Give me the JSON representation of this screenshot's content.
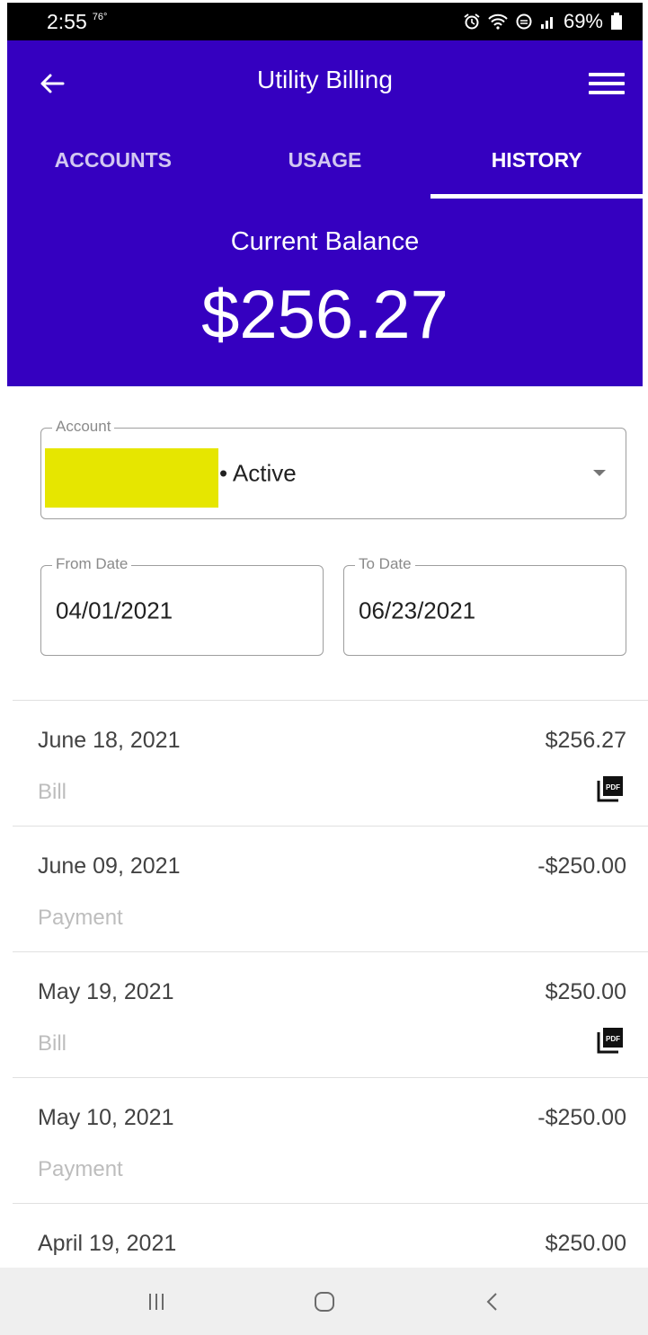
{
  "status_bar": {
    "time": "2:55",
    "temperature": "76°",
    "battery": "69%"
  },
  "header": {
    "title": "Utility Billing",
    "back_icon": "arrow-left-icon",
    "menu_icon": "hamburger-menu-icon"
  },
  "tabs": [
    {
      "label": "ACCOUNTS",
      "active": false
    },
    {
      "label": "USAGE",
      "active": false
    },
    {
      "label": "HISTORY",
      "active": true
    }
  ],
  "balance": {
    "label": "Current Balance",
    "amount": "$256.27"
  },
  "account_field": {
    "label": "Account",
    "value": "• Active"
  },
  "from_date": {
    "label": "From Date",
    "value": "04/01/2021"
  },
  "to_date": {
    "label": "To Date",
    "value": "06/23/2021"
  },
  "transactions": [
    {
      "date": "June 18, 2021",
      "type": "Bill",
      "amount": "$256.27",
      "has_pdf": true
    },
    {
      "date": "June 09, 2021",
      "type": "Payment",
      "amount": "-$250.00",
      "has_pdf": false
    },
    {
      "date": "May 19, 2021",
      "type": "Bill",
      "amount": "$250.00",
      "has_pdf": true
    },
    {
      "date": "May 10, 2021",
      "type": "Payment",
      "amount": "-$250.00",
      "has_pdf": false
    },
    {
      "date": "April 19, 2021",
      "type": "",
      "amount": "$250.00",
      "has_pdf": false
    }
  ],
  "pdf_icon_text": "PDF",
  "colors": {
    "brand": "#3500c0",
    "redaction": "#e6e600"
  }
}
